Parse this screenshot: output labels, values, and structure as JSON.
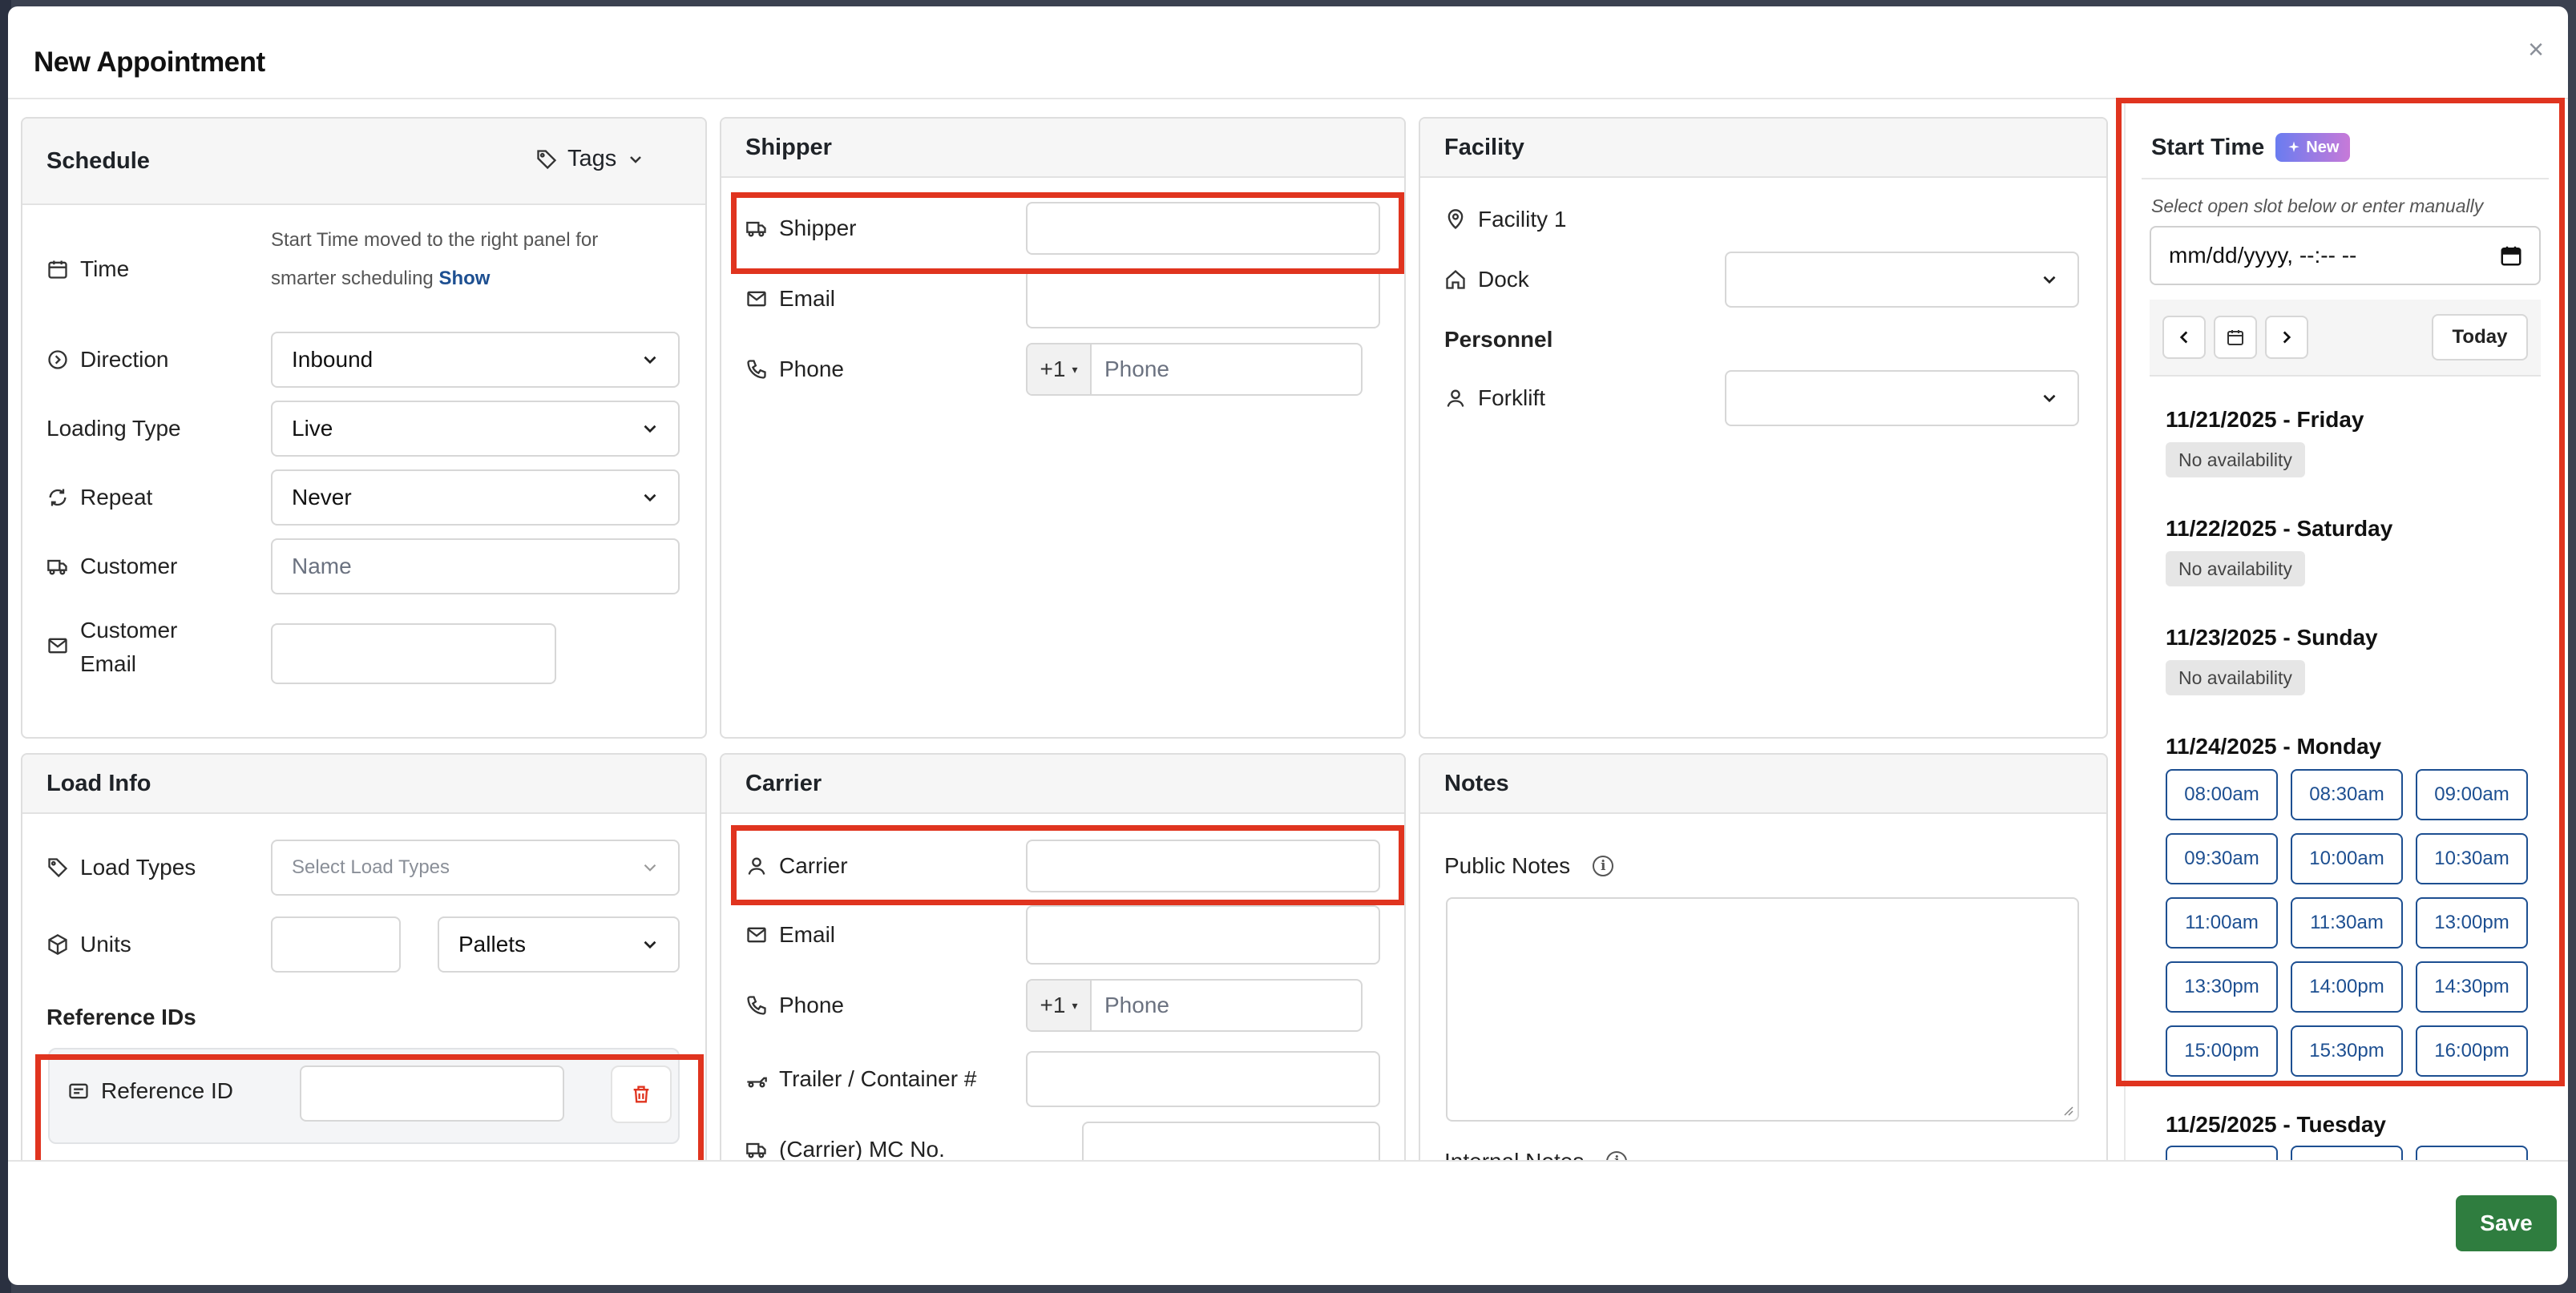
{
  "modal": {
    "title": "New Appointment",
    "close": "×"
  },
  "schedule": {
    "heading": "Schedule",
    "tags_label": "Tags",
    "time_label": "Time",
    "time_helper_1": "Start Time moved to the right panel for",
    "time_helper_2": "smarter scheduling",
    "time_helper_show": "Show",
    "direction_label": "Direction",
    "direction_value": "Inbound",
    "loading_type_label": "Loading Type",
    "loading_type_value": "Live",
    "repeat_label": "Repeat",
    "repeat_value": "Never",
    "customer_label": "Customer",
    "customer_placeholder": "Name",
    "customer_email_label_1": "Customer",
    "customer_email_label_2": "Email"
  },
  "shipper": {
    "heading": "Shipper",
    "shipper_label": "Shipper",
    "email_label": "Email",
    "phone_label": "Phone",
    "phone_prefix": "+1",
    "phone_placeholder": "Phone"
  },
  "facility": {
    "heading": "Facility",
    "facility_name": "Facility 1",
    "dock_label": "Dock",
    "personnel_heading": "Personnel",
    "forklift_label": "Forklift"
  },
  "load_info": {
    "heading": "Load Info",
    "load_types_label": "Load Types",
    "load_types_placeholder": "Select Load Types",
    "units_label": "Units",
    "units_type_value": "Pallets",
    "reference_ids_heading": "Reference IDs",
    "reference_id_label": "Reference ID"
  },
  "carrier": {
    "heading": "Carrier",
    "carrier_label": "Carrier",
    "email_label": "Email",
    "phone_label": "Phone",
    "phone_prefix": "+1",
    "phone_placeholder": "Phone",
    "trailer_label": "Trailer / Container #",
    "mc_label": "(Carrier) MC No."
  },
  "notes": {
    "heading": "Notes",
    "public_notes_label": "Public Notes",
    "internal_notes_label": "Internal Notes",
    "info_glyph": "i"
  },
  "start_time": {
    "heading": "Start Time",
    "badge": "New",
    "hint": "Select open slot below or enter manually",
    "datetime_placeholder": "mm/dd/yyyy, --:-- --",
    "today_label": "Today",
    "days": [
      {
        "label": "11/21/2025 - Friday",
        "status": "No availability"
      },
      {
        "label": "11/22/2025 - Saturday",
        "status": "No availability"
      },
      {
        "label": "11/23/2025 - Sunday",
        "status": "No availability"
      },
      {
        "label": "11/24/2025 - Monday",
        "slots": [
          "08:00am",
          "08:30am",
          "09:00am",
          "09:30am",
          "10:00am",
          "10:30am",
          "11:00am",
          "11:30am",
          "13:00pm",
          "13:30pm",
          "14:00pm",
          "14:30pm",
          "15:00pm",
          "15:30pm",
          "16:00pm"
        ]
      },
      {
        "label": "11/25/2025 - Tuesday"
      }
    ]
  },
  "footer": {
    "save_label": "Save"
  },
  "colors": {
    "highlight": "#e0341f",
    "save": "#2f7d3f",
    "slot": "#1d4f91"
  }
}
